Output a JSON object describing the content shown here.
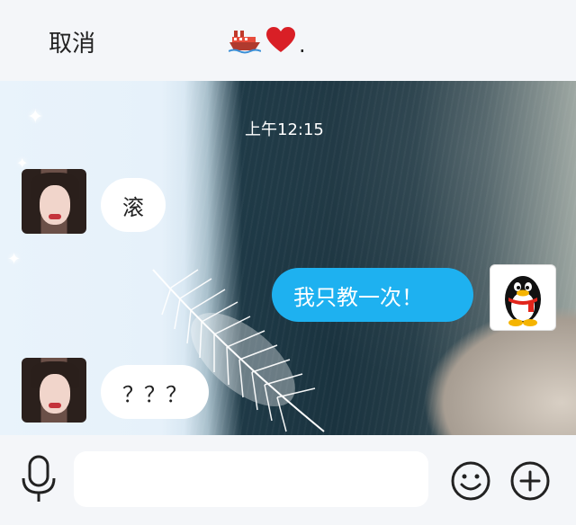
{
  "header": {
    "cancel_label": "取消",
    "title_suffix": ".",
    "title_icons": [
      "ship-icon",
      "heart-icon"
    ]
  },
  "chat": {
    "timestamp": "上午12:15",
    "messages": [
      {
        "side": "left",
        "text": "滚",
        "avatar": "girl-avatar"
      },
      {
        "side": "right",
        "text": "我只教一次！",
        "avatar": "qq-penguin-avatar"
      },
      {
        "side": "left",
        "text": "？？？",
        "avatar": "girl-avatar"
      }
    ]
  },
  "input_bar": {
    "placeholder": "",
    "icons": [
      "microphone-icon",
      "emoji-icon",
      "plus-icon"
    ]
  },
  "colors": {
    "accent_bubble": "#1eb1f0",
    "header_bg": "#f4f6f9"
  }
}
